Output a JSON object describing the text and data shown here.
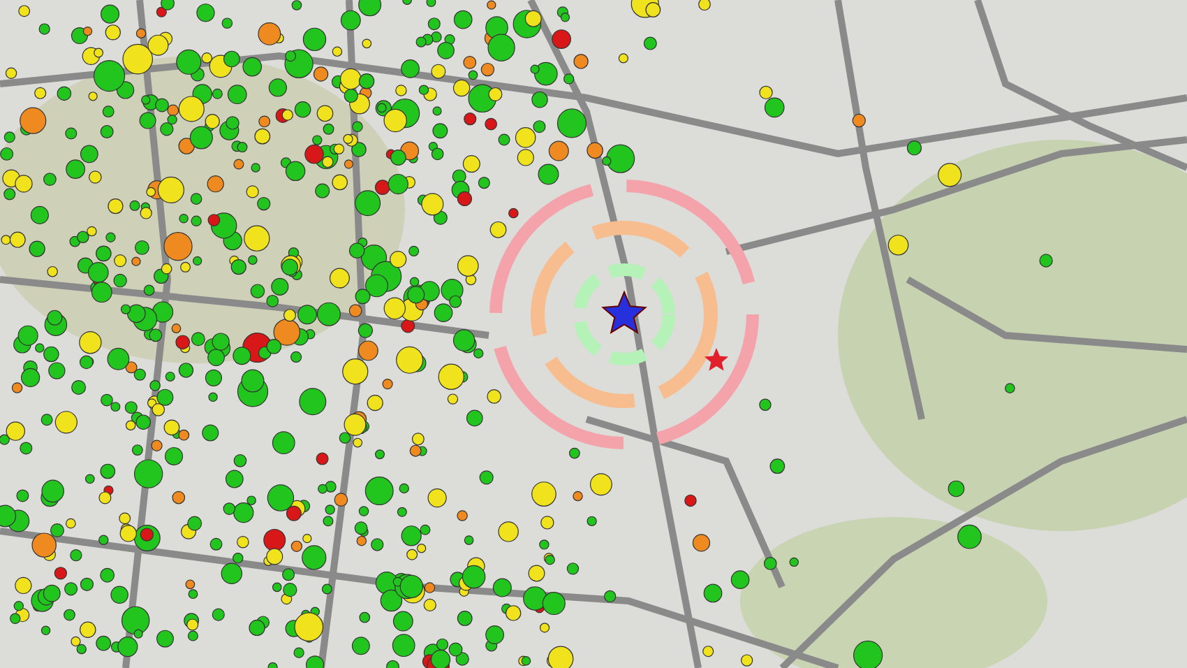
{
  "rings": [
    {
      "color": "#f4a3ab"
    },
    {
      "color": "#f7bd8e"
    },
    {
      "color": "#b4f2b8"
    }
  ],
  "epicenter": {
    "color": "#2630dc"
  },
  "station": {
    "color": "#e0202a"
  },
  "markers": [
    {
      "color": "#22c41e"
    },
    {
      "color": "#f0e21c"
    },
    {
      "color": "#ee8a20"
    },
    {
      "color": "#d81818"
    }
  ]
}
